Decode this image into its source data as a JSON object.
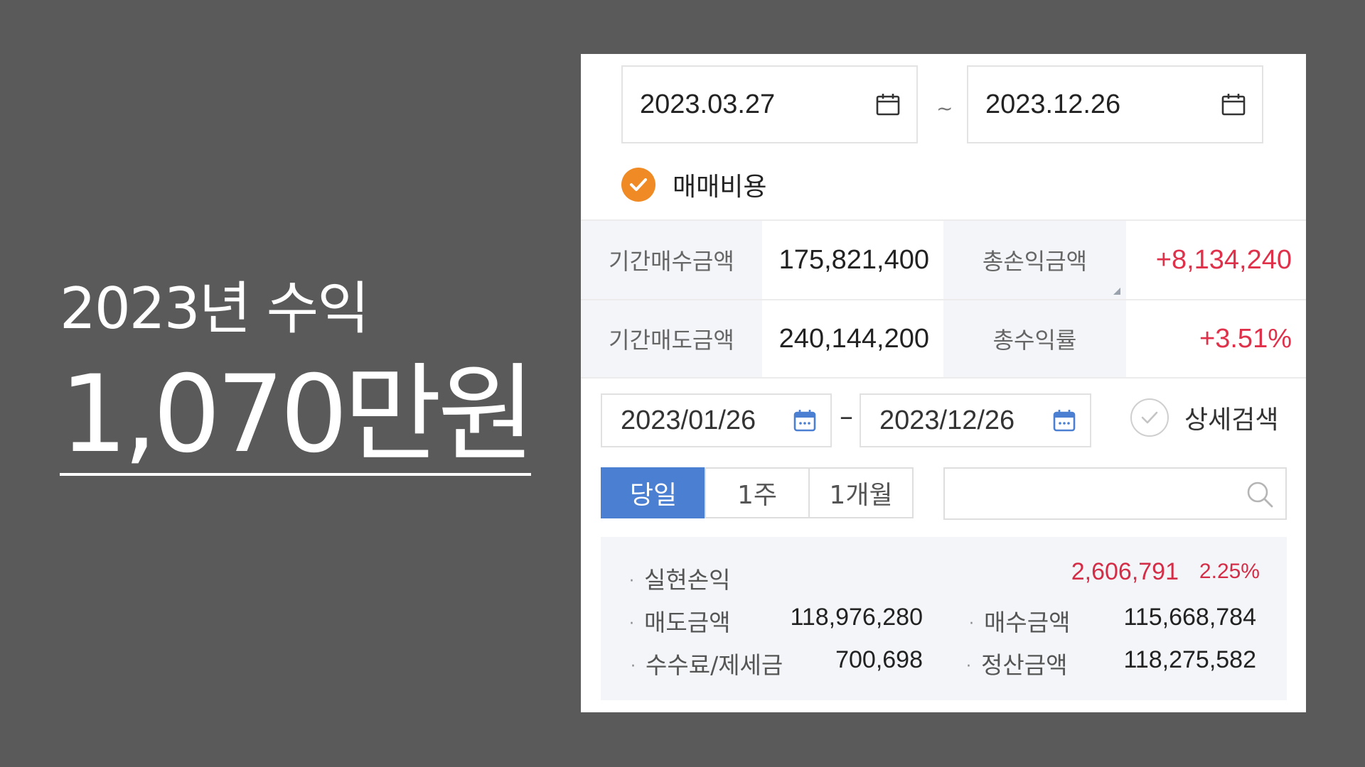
{
  "headline": {
    "subtitle": "2023년 수익",
    "amount": "1,070만원"
  },
  "date_range": {
    "start": "2023.03.27",
    "separator": "~",
    "end": "2023.12.26",
    "icon": "calendar-icon"
  },
  "trading_fee_option": {
    "label": "매매비용",
    "checked": true,
    "color": "#f08a24"
  },
  "summary": {
    "buy_label": "기간매수금액",
    "buy_value": "175,821,400",
    "total_pnl_label": "총손익금액",
    "total_pnl_value": "+8,134,240",
    "sell_label": "기간매도금액",
    "sell_value": "240,144,200",
    "total_return_label": "총수익률",
    "total_return_value": "+3.51%",
    "positive_color": "#e0314b"
  },
  "filter": {
    "start_date": "2023/01/26",
    "separator": "–",
    "end_date": "2023/12/26",
    "detail_search_label": "상세검색",
    "tabs": [
      {
        "label": "당일",
        "active": true
      },
      {
        "label": "1주",
        "active": false
      },
      {
        "label": "1개월",
        "active": false
      }
    ],
    "search_placeholder": "",
    "active_color": "#4a7fd1"
  },
  "realized": {
    "pnl_label": "실현손익",
    "pnl_value": "2,606,791",
    "pnl_rate": "2.25%",
    "sell_label": "매도금액",
    "sell_value": "118,976,280",
    "buy_label": "매수금액",
    "buy_value": "115,668,784",
    "fee_label": "수수료/제세금",
    "fee_value": "700,698",
    "settle_label": "정산금액",
    "settle_value": "118,275,582"
  }
}
